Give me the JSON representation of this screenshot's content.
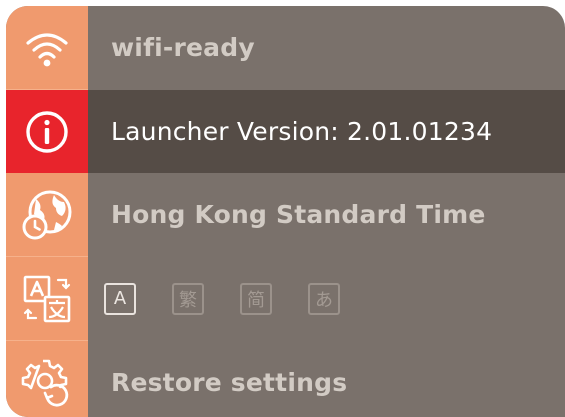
{
  "rows": {
    "wifi": {
      "label": "wifi-ready",
      "icon": "wifi-icon"
    },
    "version": {
      "label": "Launcher Version: 2.01.01234",
      "icon": "info-icon"
    },
    "timezone": {
      "label": "Hong Kong Standard Time",
      "icon": "globe-clock-icon"
    },
    "language": {
      "icon": "translate-icon",
      "options": [
        "A",
        "繁",
        "简",
        "あ"
      ],
      "selected_index": 0
    },
    "restore": {
      "label": "Restore settings",
      "icon": "gear-refresh-icon"
    }
  },
  "colors": {
    "panel_bg": "#7a716b",
    "icon_column": "#f09a6e",
    "selected_row_bg": "#554c46",
    "selected_icon_bg": "#e8242c",
    "text_muted": "#d2cbc4",
    "text_selected": "#ffffff"
  }
}
